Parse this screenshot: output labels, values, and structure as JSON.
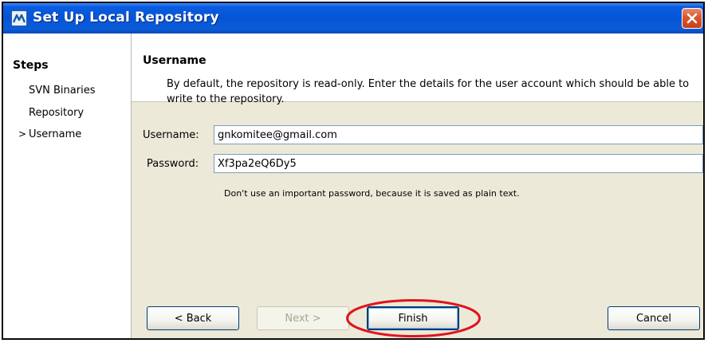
{
  "window": {
    "title": "Set Up Local Repository"
  },
  "steps": {
    "heading": "Steps",
    "items": [
      {
        "label": "SVN Binaries",
        "current": false,
        "marker": ""
      },
      {
        "label": "Repository",
        "current": false,
        "marker": ""
      },
      {
        "label": "Username",
        "current": true,
        "marker": ">"
      }
    ]
  },
  "header": {
    "title": "Username",
    "description": "By default, the repository is read-only. Enter the details for the user account which should be able to write to the repository."
  },
  "form": {
    "username_label": "Username:",
    "username_value": "gnkomitee@gmail.com",
    "password_label": "Password:",
    "password_value": "Xf3pa2eQ6Dy5",
    "hint": "Don't use an important password, because it is saved as plain text."
  },
  "buttons": {
    "back": "< Back",
    "next": "Next >",
    "finish": "Finish",
    "cancel": "Cancel"
  },
  "colors": {
    "title_bar": "#0654d6",
    "close_button": "#d8562e",
    "dialog_background": "#ECE9D8",
    "highlight_annotation": "#e0141e"
  },
  "annotation": {
    "type": "red-ellipse",
    "target": "Finish"
  }
}
